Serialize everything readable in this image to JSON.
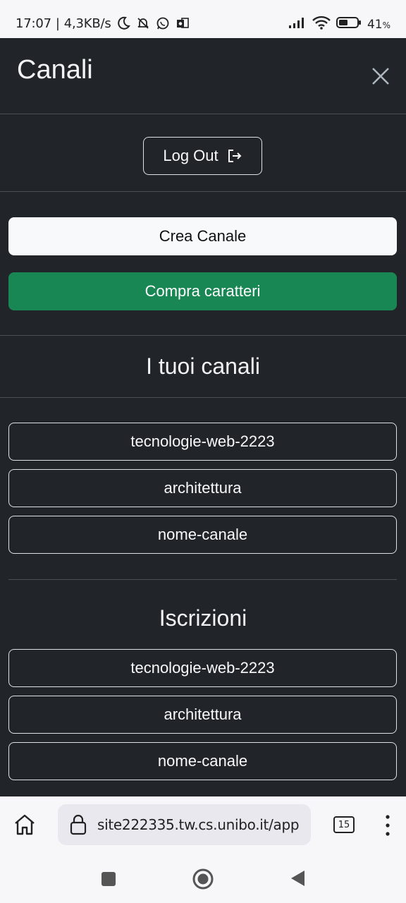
{
  "status_bar": {
    "time": "17:07",
    "network_speed": "4,3KB/s",
    "battery_percent": "41",
    "battery_unit": "%"
  },
  "header": {
    "title": "Canali"
  },
  "logout": {
    "label": "Log Out"
  },
  "actions": {
    "create_channel": "Crea Canale",
    "buy_characters": "Compra caratteri"
  },
  "my_channels": {
    "title": "I tuoi canali",
    "items": [
      "tecnologie-web-2223",
      "architettura",
      "nome-canale"
    ]
  },
  "subscriptions": {
    "title": "Iscrizioni",
    "items": [
      "tecnologie-web-2223",
      "architettura",
      "nome-canale"
    ]
  },
  "browser": {
    "url": "site222335.tw.cs.unibo.it/app",
    "tab_count": "15"
  }
}
